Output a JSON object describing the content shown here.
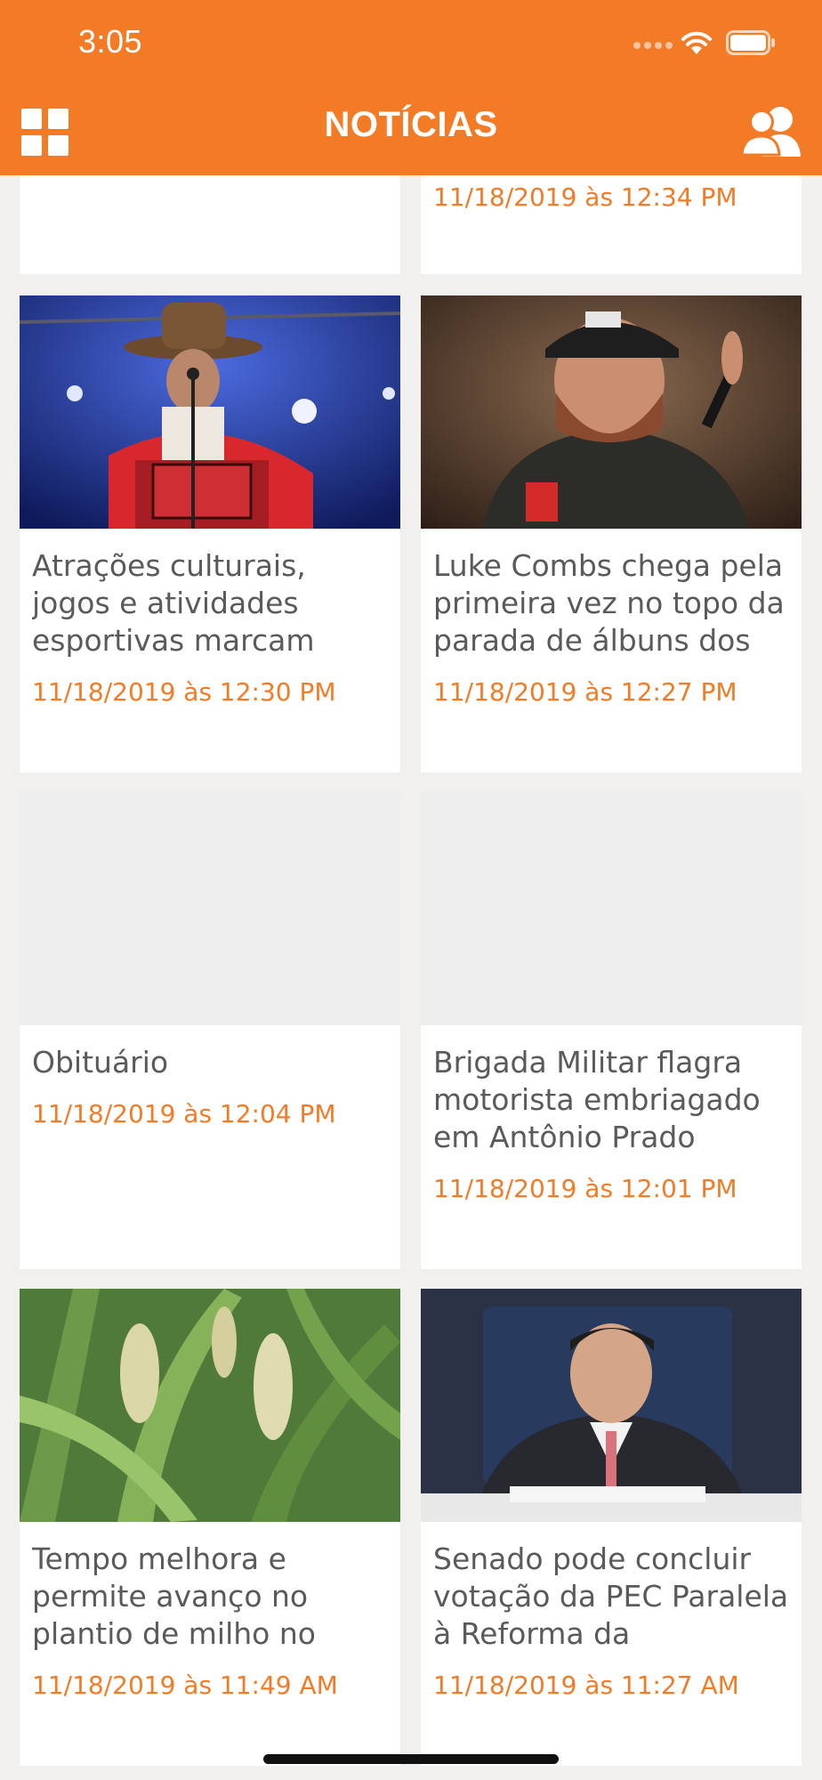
{
  "status_bar": {
    "time": "3:05"
  },
  "header": {
    "title": "NOTÍCIAS"
  },
  "colors": {
    "accent": "#f47b26",
    "text": "#5a5a5a",
    "background": "#f1f0ee"
  },
  "icons": {
    "menu": "grid-menu-icon",
    "profile": "users-icon",
    "wifi": "wifi-icon",
    "battery": "battery-icon"
  },
  "articles": [
    {
      "title": "",
      "date": ""
    },
    {
      "title": "",
      "date": "11/18/2019 às 12:34 PM"
    },
    {
      "title": "Atrações culturais, jogos e atividades esportivas marcam segundo final…",
      "date": "11/18/2019 às 12:30 PM"
    },
    {
      "title": "Luke Combs chega pela primeira vez no topo da parada de álbuns dos E…",
      "date": "11/18/2019 às 12:27 PM"
    },
    {
      "title": "Obituário",
      "date": "11/18/2019 às 12:04 PM"
    },
    {
      "title": "Brigada Militar flagra motorista embriagado em Antônio Prado",
      "date": "11/18/2019 às 12:01 PM"
    },
    {
      "title": "Tempo melhora e permite avanço no plantio de milho no Est…",
      "date": "11/18/2019 às 11:49 AM"
    },
    {
      "title": "Senado pode concluir votação da PEC Paralela à Reforma da Previdên…",
      "date": "11/18/2019 às 11:27 AM"
    }
  ]
}
